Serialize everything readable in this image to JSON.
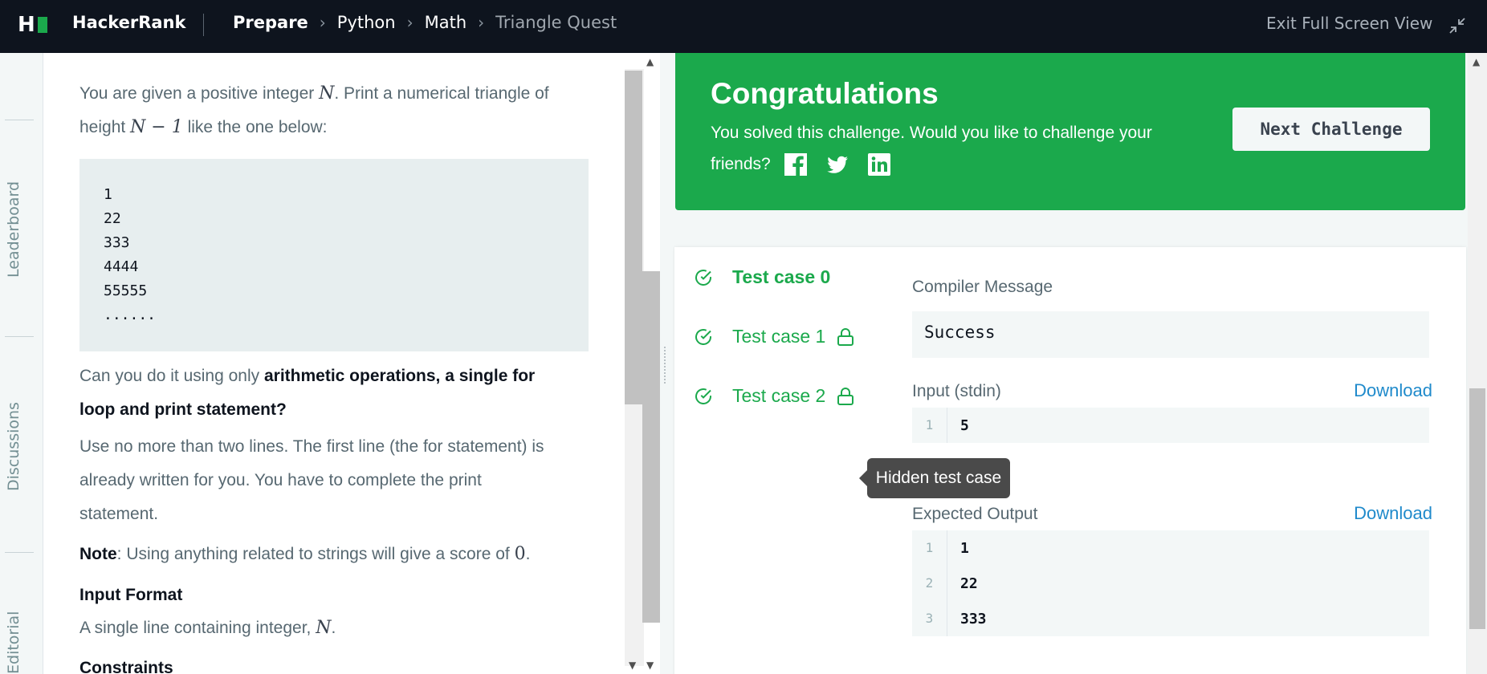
{
  "header": {
    "brand": "HackerRank",
    "breadcrumbs": [
      "Prepare",
      "Python",
      "Math",
      "Triangle Quest"
    ],
    "exit_fullscreen": "Exit Full Screen View"
  },
  "rail": {
    "tabs": [
      "Leaderboard",
      "Discussions",
      "Editorial"
    ]
  },
  "problem": {
    "intro_1": "You are given a positive integer ",
    "intro_var": "N",
    "intro_2": ". Print a numerical triangle of",
    "intro_3": "height ",
    "intro_expr": "N − 1",
    "intro_4": " like the one below:",
    "sample_lines": [
      "1",
      "22",
      "333",
      "4444",
      "55555",
      "......"
    ],
    "q_pre": "Can you do it using only ",
    "q_bold_1": "arithmetic operations, a single for",
    "q_bold_2": "loop and print statement?",
    "rule_1": "Use no more than two lines. The first line (the for statement) is",
    "rule_2": "already written for you. You have to complete the print",
    "rule_3": "statement.",
    "note_label": "Note",
    "note_text": ": Using anything related to strings will give a score of ",
    "note_zero": "0",
    "note_end": ".",
    "input_format_heading": "Input Format",
    "input_format_text": "A single line containing integer, ",
    "input_var": "N",
    "input_end": ".",
    "constraints_heading": "Constraints"
  },
  "congrats": {
    "title": "Congratulations",
    "sub_1": "You solved this challenge. Would you like to challenge your",
    "sub_2": "friends?",
    "next_button": "Next Challenge",
    "bg_color": "#1ba94c"
  },
  "results": {
    "test_cases": [
      {
        "label": "Test case 0",
        "status": "passed",
        "locked": false,
        "selected": true
      },
      {
        "label": "Test case 1",
        "status": "passed",
        "locked": true,
        "selected": false
      },
      {
        "label": "Test case 2",
        "status": "passed",
        "locked": true,
        "selected": false
      }
    ],
    "tooltip": "Hidden test case",
    "compiler_label": "Compiler Message",
    "compiler_value": "Success",
    "input_label": "Input (stdin)",
    "input_download": "Download",
    "input_lines": [
      {
        "n": "1",
        "v": "5"
      }
    ],
    "expected_label": "Expected Output",
    "expected_download": "Download",
    "expected_lines": [
      {
        "n": "1",
        "v": "1"
      },
      {
        "n": "2",
        "v": "22"
      },
      {
        "n": "3",
        "v": "333"
      }
    ]
  }
}
